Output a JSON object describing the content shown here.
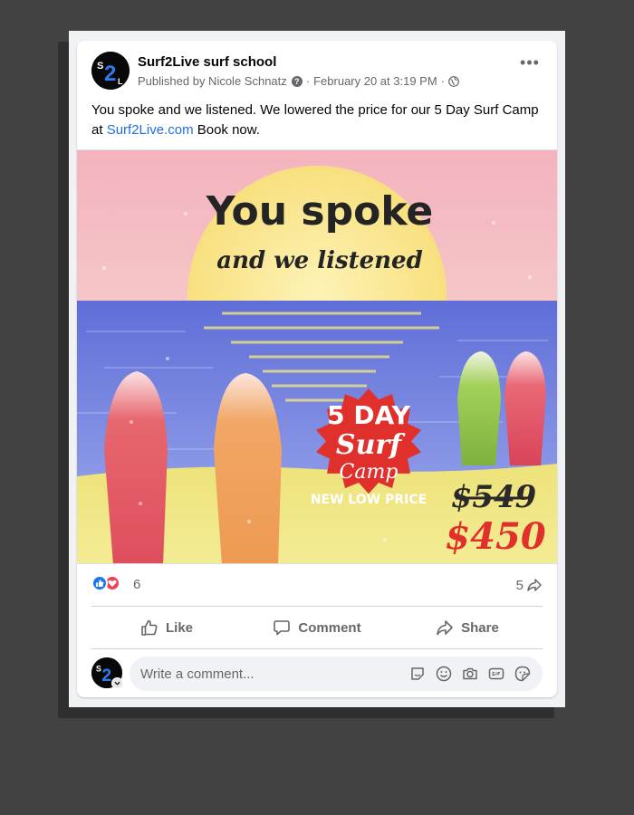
{
  "post": {
    "page_name": "Surf2Live surf school",
    "published_by": "Published by Nicole Schnatz",
    "help_glyph": "?",
    "separator": "·",
    "date": "February 20 at 3:19 PM",
    "text_before_link": "You spoke and we listened. We lowered the price for our 5 Day Surf Camp at ",
    "link_text": "Surf2Live.com",
    "text_after_link": " Book now.",
    "more_glyph": "•••"
  },
  "avatar": {
    "s": "S",
    "two": "2",
    "l": "L"
  },
  "image": {
    "headline": "You spoke",
    "subline": "and we listened",
    "badge_line1": "5 DAY",
    "badge_line2": "Surf",
    "badge_line3": "Camp",
    "badge_line4": "NEW LOW PRICE",
    "old_price": "$549",
    "new_price": "$450",
    "colors": {
      "sky_top": "#f2b9c2",
      "sun": "#fbe89b",
      "sea": "#6f7fe0",
      "sand": "#f2ea88",
      "badge": "#e0302b"
    }
  },
  "engagement": {
    "reaction_count": "6",
    "share_count": "5"
  },
  "actions": {
    "like": "Like",
    "comment": "Comment",
    "share": "Share"
  },
  "comment_input": {
    "placeholder": "Write a comment..."
  },
  "icons": [
    "more-options-icon",
    "help-icon",
    "globe-icon",
    "like-reaction-icon",
    "love-reaction-icon",
    "share-arrow-icon",
    "thumbs-up-icon",
    "comment-bubble-icon",
    "share-icon",
    "sticker-icon",
    "emoji-icon",
    "camera-icon",
    "gif-icon",
    "avatar-sticker-icon"
  ]
}
